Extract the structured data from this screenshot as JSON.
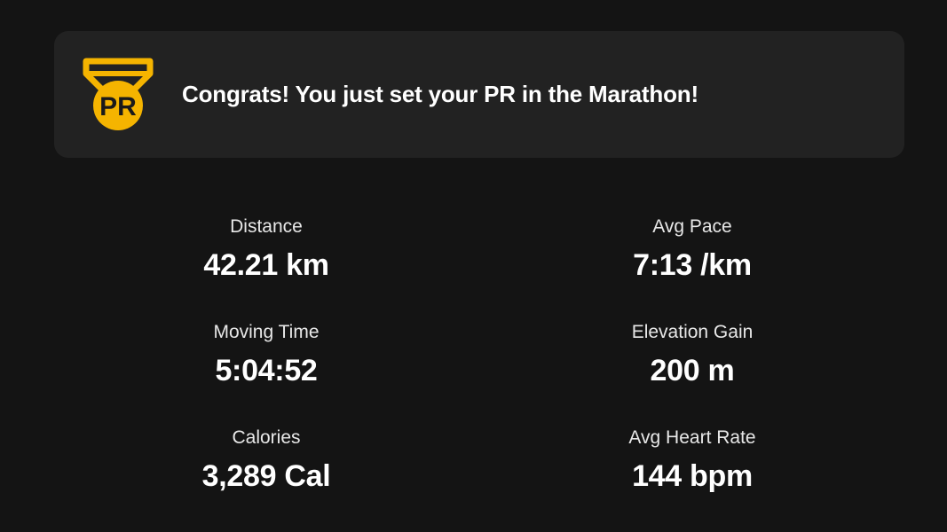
{
  "banner": {
    "badge_text": "PR",
    "message": "Congrats! You just set your PR in the Marathon!",
    "accent_color": "#F5B400",
    "icon": "pr-medal-icon"
  },
  "stats": [
    {
      "label": "Distance",
      "value": "42.21 km"
    },
    {
      "label": "Avg Pace",
      "value": "7:13 /km"
    },
    {
      "label": "Moving Time",
      "value": "5:04:52"
    },
    {
      "label": "Elevation Gain",
      "value": "200 m"
    },
    {
      "label": "Calories",
      "value": "3,289 Cal"
    },
    {
      "label": "Avg Heart Rate",
      "value": "144 bpm"
    }
  ]
}
